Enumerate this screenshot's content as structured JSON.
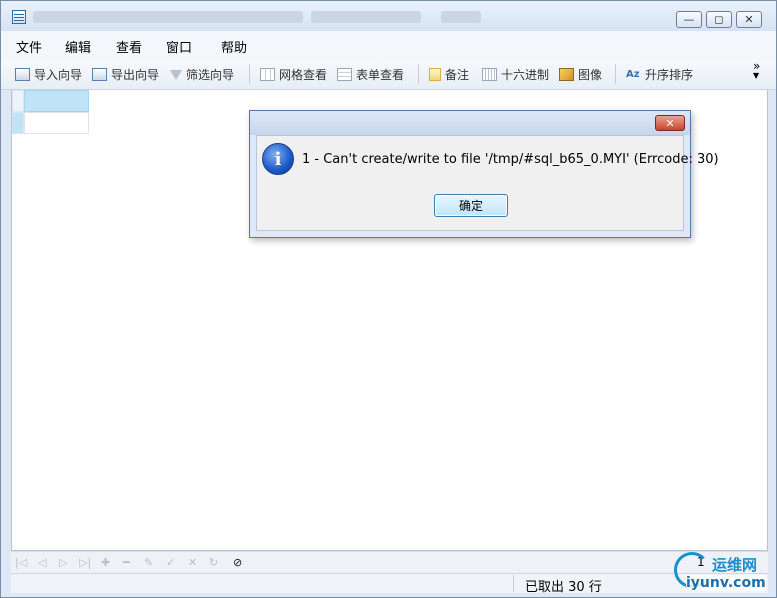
{
  "menu": [
    "文件",
    "编辑",
    "查看",
    "窗口",
    "帮助"
  ],
  "toolbar": {
    "import_wizard": "导入向导",
    "export_wizard": "导出向导",
    "filter_wizard": "筛选向导",
    "grid_view": "网格查看",
    "form_view": "表单查看",
    "memo": "备注",
    "hex": "十六进制",
    "image": "图像",
    "sort_asc": "升序排序",
    "overflow": "»"
  },
  "dialog": {
    "close_glyph": "✕",
    "info_glyph": "i",
    "message": "1 - Can't create/write to file '/tmp/#sql_b65_0.MYI' (Errcode: 30)",
    "ok_label": "确定"
  },
  "status": {
    "rows_fetched": "已取出 30 行"
  },
  "pager": {
    "page_value": "1"
  },
  "watermark": {
    "top": "运维网",
    "bottom": "iyunv.com"
  },
  "icons": {
    "minimize": "—",
    "maximize": "◻",
    "close": "✕"
  }
}
